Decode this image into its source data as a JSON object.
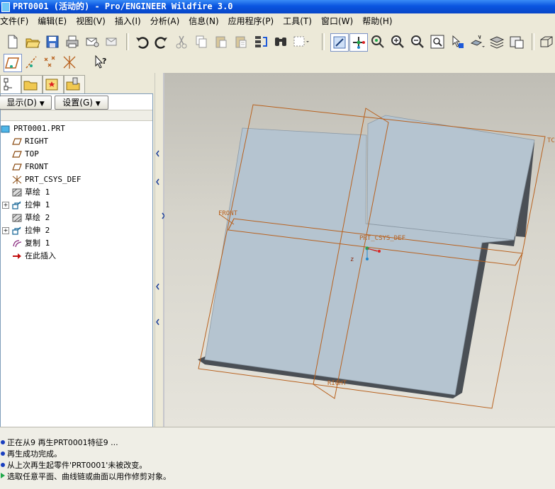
{
  "window": {
    "title": "PRT0001 (活动的) - Pro/ENGINEER Wildfire 3.0"
  },
  "menu": [
    "文件(F)",
    "编辑(E)",
    "视图(V)",
    "插入(I)",
    "分析(A)",
    "信息(N)",
    "应用程序(P)",
    "工具(T)",
    "窗口(W)",
    "帮助(H)"
  ],
  "toolbar_icons": [
    "new-icon",
    "open-icon",
    "save-icon",
    "print-icon",
    "mail-icon",
    "mail-attach-icon",
    "undo-icon",
    "redo-icon",
    "cut-icon",
    "copy-icon",
    "paste-icon",
    "paste-special-icon",
    "regenerate-icon",
    "find-icon",
    "select-box-icon",
    "repaint-icon",
    "spin-center-icon",
    "orient-icon",
    "zoom-in-icon",
    "zoom-out-icon",
    "refit-icon",
    "reorient-icon",
    "named-views-icon",
    "layers-icon",
    "view-manager-icon",
    "display-style-icon"
  ],
  "datum_toggles": [
    "plane-display-icon",
    "axis-display-icon",
    "point-display-icon",
    "csys-display-icon",
    "context-help-icon"
  ],
  "nav_tabs": [
    "model-tree-tab",
    "folder-browser-tab",
    "favorites-tab",
    "connections-tab"
  ],
  "panel": {
    "show_label": "显示(D)",
    "settings_label": "设置(G)"
  },
  "tree": [
    {
      "label": "PRT0001.PRT",
      "icon": "part-icon",
      "expand": false
    },
    {
      "label": "RIGHT",
      "icon": "datum-plane-icon",
      "expand": false
    },
    {
      "label": "TOP",
      "icon": "datum-plane-icon",
      "expand": false
    },
    {
      "label": "FRONT",
      "icon": "datum-plane-icon",
      "expand": false
    },
    {
      "label": "PRT_CSYS_DEF",
      "icon": "csys-icon",
      "expand": false
    },
    {
      "label": "草绘 1",
      "icon": "sketch-icon",
      "expand": false
    },
    {
      "label": "拉伸 1",
      "icon": "extrude-icon",
      "expand": true
    },
    {
      "label": "草绘 2",
      "icon": "sketch-icon",
      "expand": false
    },
    {
      "label": "拉伸 2",
      "icon": "extrude-icon",
      "expand": true
    },
    {
      "label": "复制 1",
      "icon": "copy-surface-icon",
      "expand": false
    },
    {
      "label": "在此插入",
      "icon": "insert-here-arrow-icon",
      "expand": false
    }
  ],
  "viewport": {
    "labels": {
      "front": "FRONT",
      "csys": "PRT_CSYS_DEF",
      "right": "RIGHT",
      "top": "TC",
      "z": "z"
    },
    "colors": {
      "datum": "#b8611e",
      "part": "#b5c4d0",
      "part_edge": "#4a4f55"
    }
  },
  "messages": [
    "正在从9 再生PRT0001特征9 ...",
    "再生成功完成。",
    "从上次再生起零件'PRT0001'未被改变。",
    "选取任意平面、曲线链或曲面以用作修剪对象。"
  ]
}
